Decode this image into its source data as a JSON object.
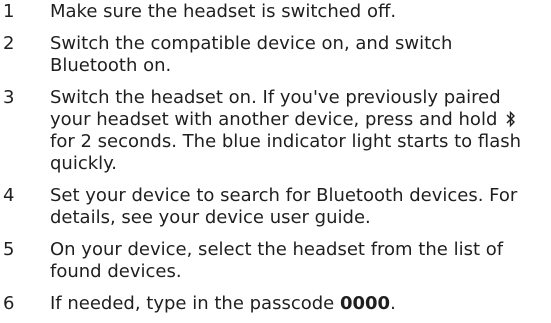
{
  "steps": [
    {
      "number": "1",
      "text": "Make sure the headset is switched off."
    },
    {
      "number": "2",
      "text": "Switch the compatible device on, and switch Bluetooth on."
    },
    {
      "number": "3",
      "text_before": "Switch the headset on. If you've previously paired your headset with another device, press and hold",
      "icon": "bluetooth-icon",
      "text_after": "for 2 seconds. The blue indicator light starts to flash quickly."
    },
    {
      "number": "4",
      "text": "Set your device to search for Bluetooth devices. For details, see your device user guide."
    },
    {
      "number": "5",
      "text": "On your device, select the headset from the list of found devices."
    },
    {
      "number": "6",
      "text_before": "If needed, type in the passcode",
      "passcode": "0000",
      "text_after": "."
    }
  ]
}
